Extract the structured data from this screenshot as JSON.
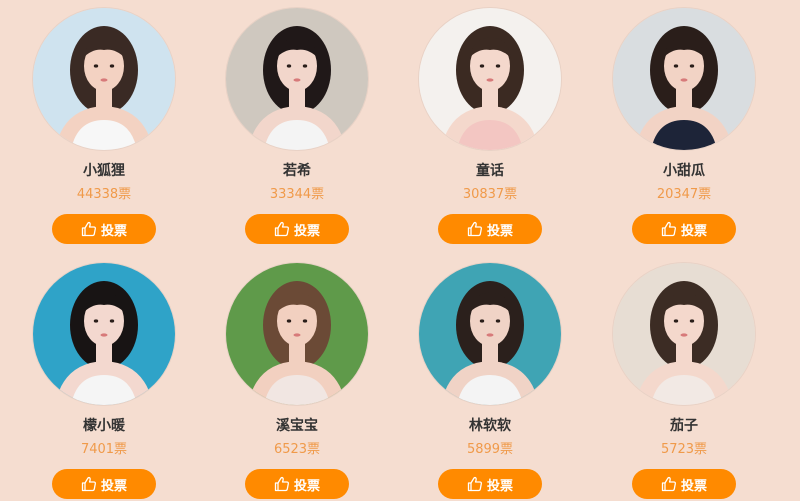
{
  "vote_label": "投票",
  "contestants": [
    {
      "name": "小狐狸",
      "votes": "44338票",
      "bg": "#cfe3ef",
      "hair": "#3a2a24",
      "skin": "#f3d2c2",
      "cloth": "#f7f7f7"
    },
    {
      "name": "若希",
      "votes": "33344票",
      "bg": "#cfc8bf",
      "hair": "#201818",
      "skin": "#f2d6cb",
      "cloth": "#f4f4f4"
    },
    {
      "name": "童话",
      "votes": "30837票",
      "bg": "#f4f1ee",
      "hair": "#3b2a22",
      "skin": "#f4d8cc",
      "cloth": "#f3c6c2"
    },
    {
      "name": "小甜瓜",
      "votes": "20347票",
      "bg": "#d9dde0",
      "hair": "#2a1e1a",
      "skin": "#f2d3c5",
      "cloth": "#1d2438"
    },
    {
      "name": "檬小暖",
      "votes": "7401票",
      "bg": "#2fa3c8",
      "hair": "#181414",
      "skin": "#f3d8cf",
      "cloth": "#f5f5f5"
    },
    {
      "name": "溪宝宝",
      "votes": "6523票",
      "bg": "#5f9a4a",
      "hair": "#6b4a36",
      "skin": "#f2d0c0",
      "cloth": "#f1e6e2"
    },
    {
      "name": "林软软",
      "votes": "5899票",
      "bg": "#3fa4b4",
      "hair": "#2b201c",
      "skin": "#f0d3c6",
      "cloth": "#f4f4f4"
    },
    {
      "name": "茄子",
      "votes": "5723票",
      "bg": "#e7ddd3",
      "hair": "#3c2c24",
      "skin": "#f4d8cc",
      "cloth": "#f2e9e4"
    }
  ]
}
